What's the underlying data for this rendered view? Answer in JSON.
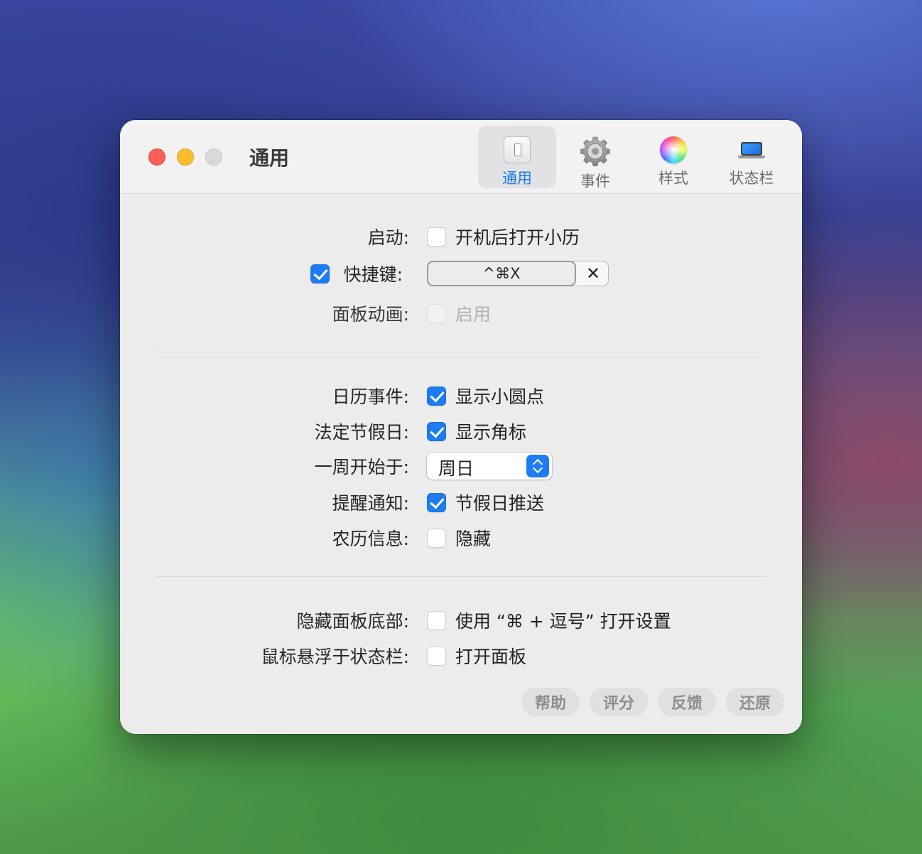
{
  "window": {
    "title": "通用"
  },
  "toolbar": {
    "tabs": [
      {
        "label": "通用",
        "icon": "switch-icon",
        "active": true
      },
      {
        "label": "事件",
        "icon": "gear-icon",
        "active": false
      },
      {
        "label": "样式",
        "icon": "color-wheel-icon",
        "active": false
      },
      {
        "label": "状态栏",
        "icon": "laptop-icon",
        "active": false
      }
    ]
  },
  "general": {
    "launch": {
      "label": "启动:",
      "option": "开机后打开小历",
      "checked": false
    },
    "hotkey": {
      "label": "快捷键:",
      "enabled": true,
      "value": "^⌘X",
      "clear": "✕"
    },
    "animation": {
      "label": "面板动画:",
      "option": "启用",
      "checked": false,
      "disabled": true
    }
  },
  "calendar": {
    "events": {
      "label": "日历事件:",
      "option": "显示小圆点",
      "checked": true
    },
    "holidays": {
      "label": "法定节假日:",
      "option": "显示角标",
      "checked": true
    },
    "week_start": {
      "label": "一周开始于:",
      "value": "周日"
    },
    "reminders": {
      "label": "提醒通知:",
      "option": "节假日推送",
      "checked": true
    },
    "lunar": {
      "label": "农历信息:",
      "option": "隐藏",
      "checked": false
    }
  },
  "panel": {
    "hide_bottom": {
      "label": "隐藏面板底部:",
      "option": "使用 “⌘ + 逗号” 打开设置",
      "checked": false
    },
    "hover": {
      "label": "鼠标悬浮于状态栏:",
      "option": "打开面板",
      "checked": false
    }
  },
  "footer": {
    "help": "帮助",
    "rate": "评分",
    "feedback": "反馈",
    "reset": "还原"
  },
  "colors": {
    "accent": "#1d7cf2",
    "close": "#fe5f57",
    "minimize": "#febc2e"
  }
}
